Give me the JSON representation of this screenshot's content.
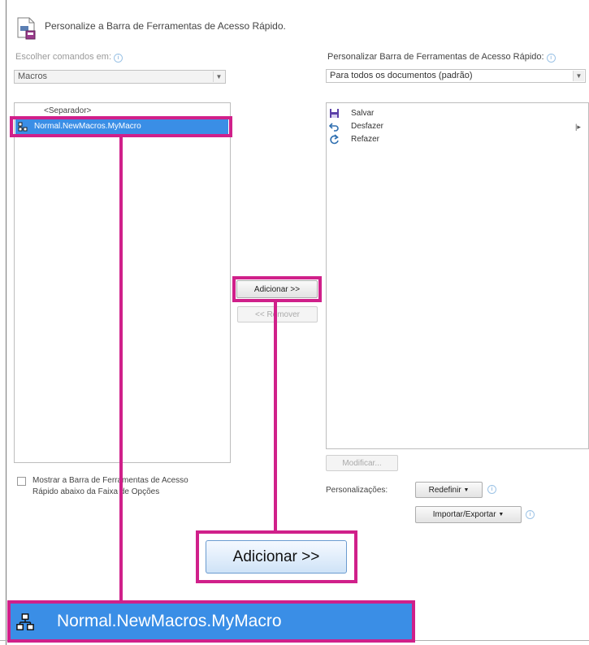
{
  "header": {
    "title": "Personalize a Barra de Ferramentas de Acesso Rápido."
  },
  "left": {
    "choose_label": "Escolher comandos em:",
    "choose_value": "Macros",
    "items": [
      "<Separador>",
      "Normal.NewMacros.MyMacro"
    ]
  },
  "right": {
    "customize_label": "Personalizar Barra de Ferramentas de Acesso Rápido:",
    "customize_value": "Para todos os documentos (padrão)",
    "items": [
      {
        "label": "Salvar",
        "icon": "save-icon"
      },
      {
        "label": "Desfazer",
        "icon": "undo-icon"
      },
      {
        "label": "Refazer",
        "icon": "redo-icon"
      }
    ]
  },
  "buttons": {
    "add": "Adicionar >>",
    "remove": "<< Remover",
    "modify": "Modificar...",
    "reset": "Redefinir",
    "import_export": "Importar/Exportar"
  },
  "customizations_label": "Personalizações:",
  "show_below_ribbon": "Mostrar a Barra de Ferramentas de Acesso Rápido abaixo da Faixa de Opções",
  "callouts": {
    "add_zoom": "Adicionar >>",
    "macro_zoom": "Normal.NewMacros.MyMacro"
  },
  "colors": {
    "highlight": "#d0208a",
    "selection": "#3a8ee6"
  }
}
